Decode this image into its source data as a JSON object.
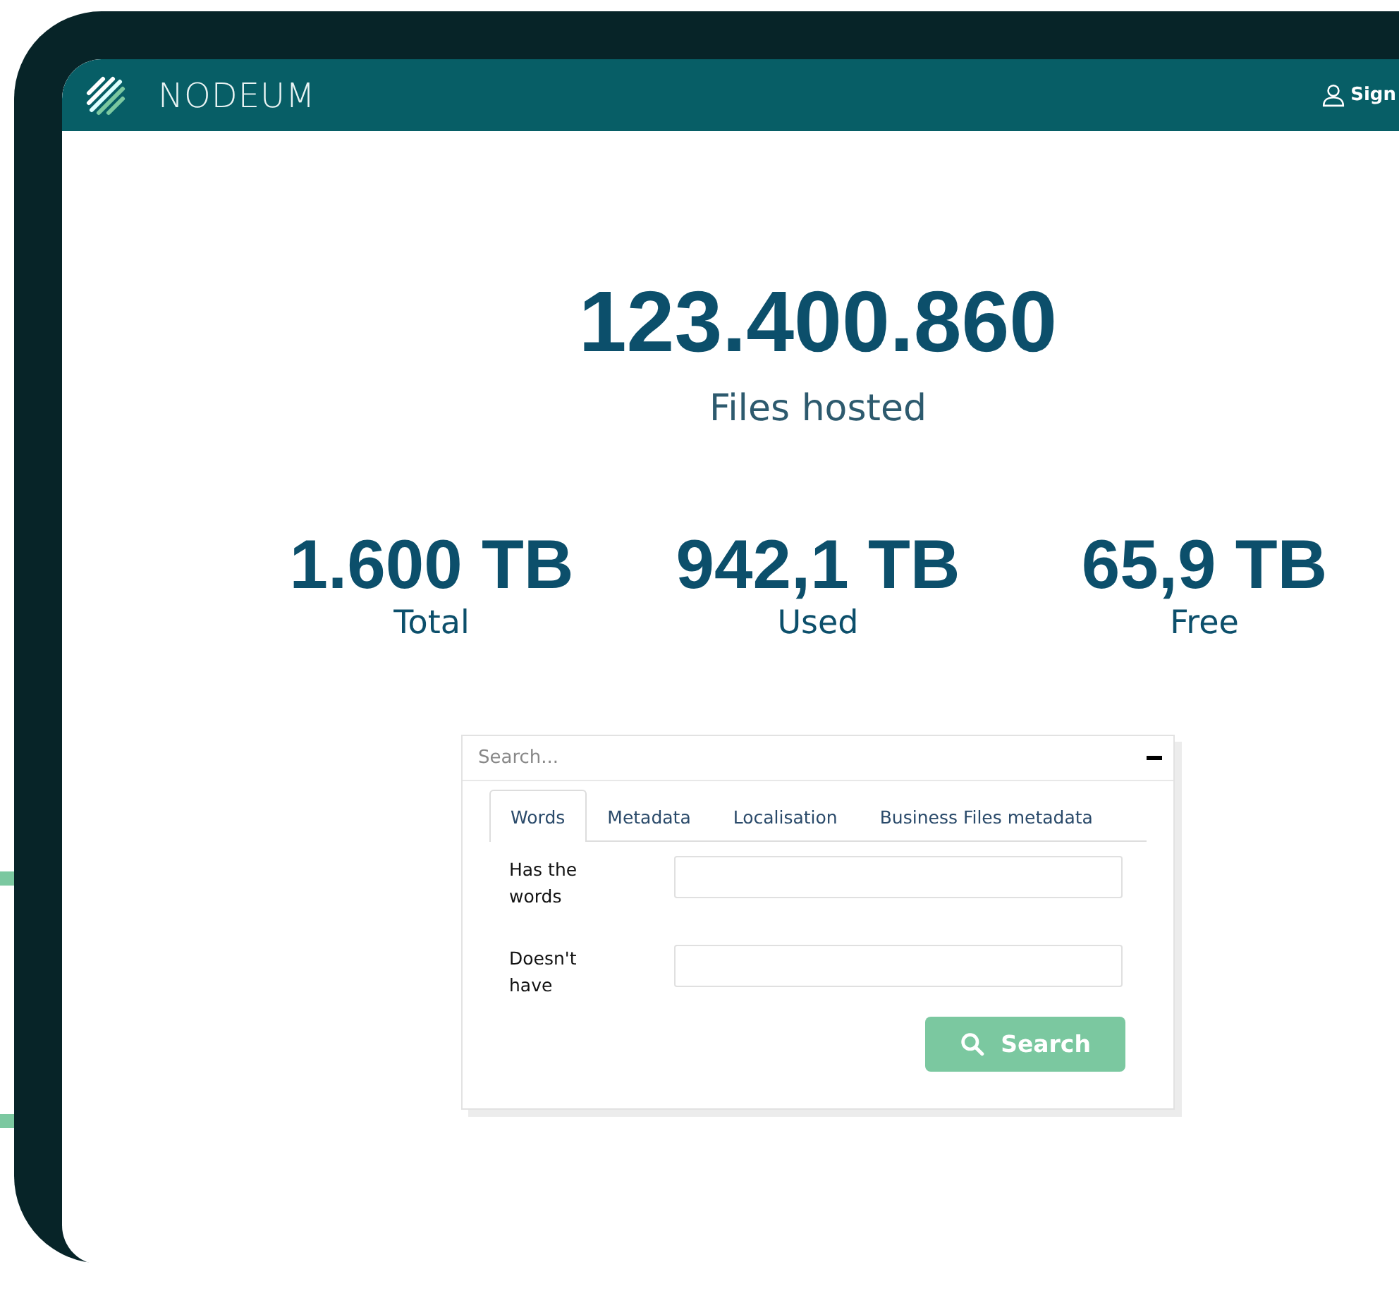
{
  "header": {
    "brand": "NODEUM",
    "account_link": "Sign"
  },
  "hero": {
    "count": "123.400.860",
    "caption": "Files hosted"
  },
  "stats": [
    {
      "value": "1.600 TB",
      "label": "Total"
    },
    {
      "value": "942,1 TB",
      "label": "Used"
    },
    {
      "value": "65,9 TB",
      "label": "Free"
    }
  ],
  "search": {
    "placeholder": "Search...",
    "expanded": true,
    "tabs": [
      {
        "label": "Words",
        "selected": true
      },
      {
        "label": "Metadata",
        "selected": false
      },
      {
        "label": "Localisation",
        "selected": false
      },
      {
        "label": "Business Files metadata",
        "selected": false
      }
    ],
    "fields": [
      {
        "label": "Has the words"
      },
      {
        "label": "Doesn't have"
      }
    ],
    "button": "Search"
  }
}
